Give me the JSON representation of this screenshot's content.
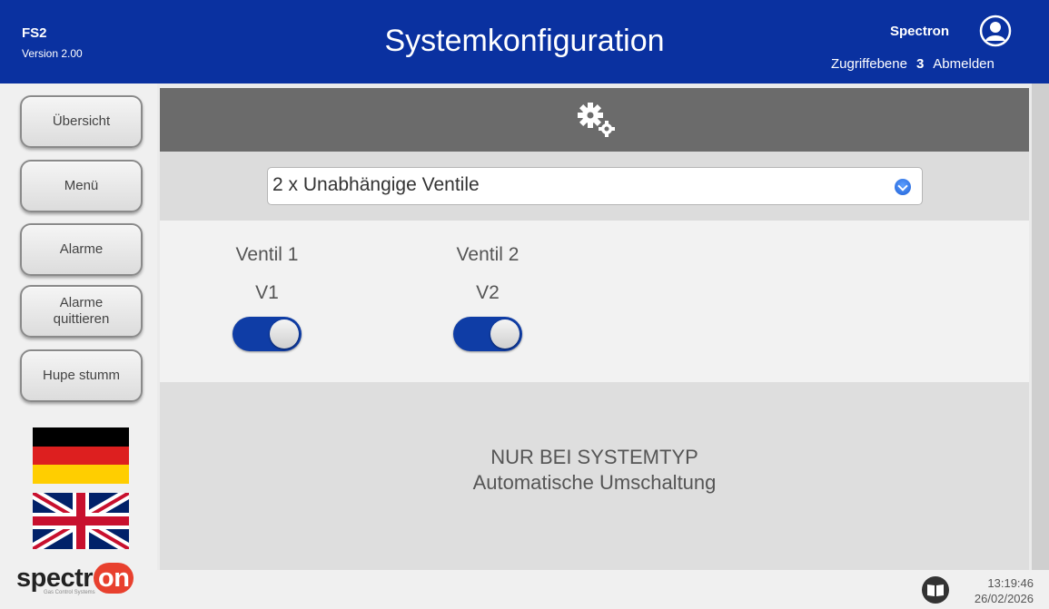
{
  "header": {
    "app_name": "FS2",
    "version": "Version 2.00",
    "title": "Systemkonfiguration",
    "user": "Spectron",
    "access_label": "Zugriffebene",
    "access_level": "3",
    "logout_label": "Abmelden"
  },
  "sidebar": {
    "buttons": [
      {
        "label": "Übersicht"
      },
      {
        "label": "Menü"
      },
      {
        "label": "Alarme"
      },
      {
        "label_line1": "Alarme",
        "label_line2": "quittieren"
      },
      {
        "label": "Hupe stumm"
      }
    ],
    "flags": [
      "germany-flag",
      "uk-flag"
    ],
    "logo": {
      "text_main": "spectr",
      "text_accent": "on",
      "tagline": "Gas Control Systems"
    }
  },
  "main": {
    "header_icon": "gears-icon",
    "system_type": {
      "selected": "2 x Unabhängige Ventile"
    },
    "valves": [
      {
        "name": "Ventil 1",
        "code": "V1",
        "on": true
      },
      {
        "name": "Ventil 2",
        "code": "V2",
        "on": true
      }
    ],
    "info_line1": "NUR BEI SYSTEMTYP",
    "info_line2": "Automatische Umschaltung"
  },
  "footer": {
    "time": "13:19:46",
    "date": "26/02/2026"
  },
  "colors": {
    "header_bg": "#0a31a0",
    "toggle_on": "#0f3da6",
    "logo_accent": "#e8402e"
  }
}
